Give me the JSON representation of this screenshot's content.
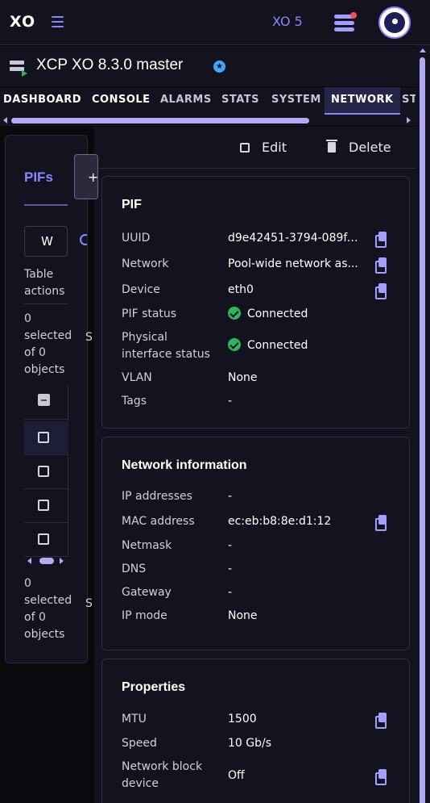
{
  "header": {
    "logo": "XO",
    "version": "XO 5"
  },
  "host": {
    "title": "XCP XO 8.3.0 master",
    "master_badge": "★"
  },
  "tabs": [
    "DASHBOARD",
    "CONSOLE",
    "ALARMS",
    "STATS",
    "SYSTEM",
    "NETWORK",
    "ST"
  ],
  "active_tab": "NETWORK",
  "pifs": {
    "title": "PIFs",
    "add_label": "+",
    "search_value": "W",
    "table_actions": "Table actions",
    "selected_top": "0 selected of 0 objects",
    "selected_bottom": "0 selected of 0 objects",
    "peek_letter": "S"
  },
  "actions": {
    "edit": "Edit",
    "delete": "Delete"
  },
  "pif_card": {
    "title": "PIF",
    "rows": [
      {
        "label": "UUID",
        "value": "d9e42451-3794-089f-..."
      },
      {
        "label": "Network",
        "value": "Pool-wide network as..."
      },
      {
        "label": "Device",
        "value": "eth0"
      },
      {
        "label": "PIF status",
        "value": "Connected"
      },
      {
        "label": "Physical interface status",
        "value": "Connected"
      },
      {
        "label": "VLAN",
        "value": "None"
      },
      {
        "label": "Tags",
        "value": "-"
      }
    ]
  },
  "network_card": {
    "title": "Network information",
    "rows": [
      {
        "label": "IP addresses",
        "value": "-"
      },
      {
        "label": "MAC address",
        "value": "ec:eb:b8:8e:d1:12"
      },
      {
        "label": "Netmask",
        "value": "-"
      },
      {
        "label": "DNS",
        "value": "-"
      },
      {
        "label": "Gateway",
        "value": "-"
      },
      {
        "label": "IP mode",
        "value": "None"
      }
    ]
  },
  "properties_card": {
    "title": "Properties",
    "rows": [
      {
        "label": "MTU",
        "value": "1500"
      },
      {
        "label": "Speed",
        "value": "10 Gb/s"
      },
      {
        "label": "Network block device",
        "value": "Off"
      }
    ]
  },
  "colors": {
    "accent": "#8f84ff",
    "status_ok": "#2fb45e",
    "panel": "#13131f"
  }
}
